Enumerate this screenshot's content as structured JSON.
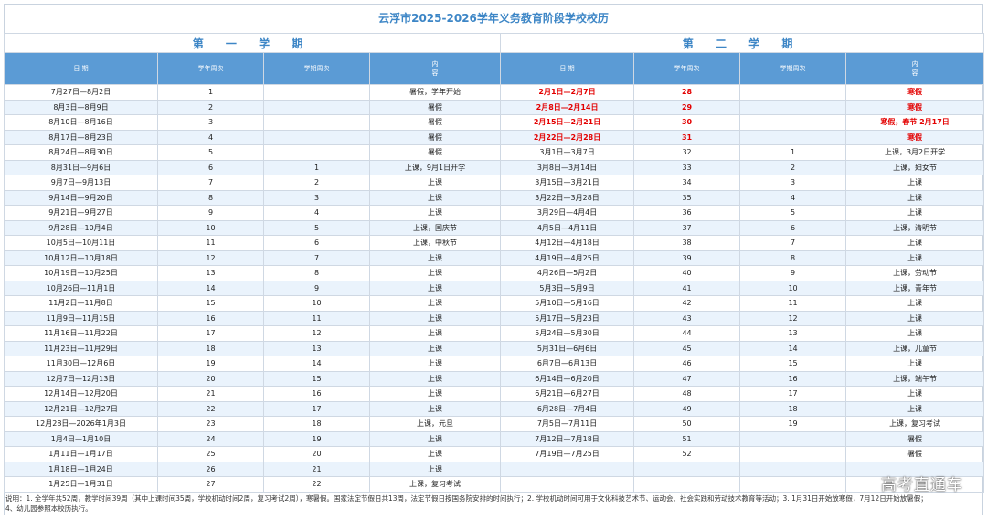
{
  "title": "云浮市2025-2026学年义务教育阶段学校校历",
  "semester1_label": "第 一 学 期",
  "semester2_label": "第 二 学 期",
  "headers": {
    "date": "日 期",
    "school_week": "学年周次",
    "term_week": "学期周次",
    "content": "内\n容"
  },
  "rows": [
    {
      "d1": "7月27日—8月2日",
      "w1": "1",
      "t1": "",
      "c1": "暑假，学年开始",
      "d2": "2月1日—2月7日",
      "w2": "28",
      "t2": "",
      "c2": "寒假",
      "hol": true
    },
    {
      "d1": "8月3日—8月9日",
      "w1": "2",
      "t1": "",
      "c1": "暑假",
      "d2": "2月8日—2月14日",
      "w2": "29",
      "t2": "",
      "c2": "寒假",
      "hol": true
    },
    {
      "d1": "8月10日—8月16日",
      "w1": "3",
      "t1": "",
      "c1": "暑假",
      "d2": "2月15日—2月21日",
      "w2": "30",
      "t2": "",
      "c2": "寒假，春节 2月17日",
      "hol": true
    },
    {
      "d1": "8月17日—8月23日",
      "w1": "4",
      "t1": "",
      "c1": "暑假",
      "d2": "2月22日—2月28日",
      "w2": "31",
      "t2": "",
      "c2": "寒假",
      "hol": true
    },
    {
      "d1": "8月24日—8月30日",
      "w1": "5",
      "t1": "",
      "c1": "暑假",
      "d2": "3月1日—3月7日",
      "w2": "32",
      "t2": "1",
      "c2": "上课，3月2日开学",
      "hol": false
    },
    {
      "d1": "8月31日—9月6日",
      "w1": "6",
      "t1": "1",
      "c1": "上课，9月1日开学",
      "d2": "3月8日—3月14日",
      "w2": "33",
      "t2": "2",
      "c2": "上课，妇女节",
      "hol": false
    },
    {
      "d1": "9月7日—9月13日",
      "w1": "7",
      "t1": "2",
      "c1": "上课",
      "d2": "3月15日—3月21日",
      "w2": "34",
      "t2": "3",
      "c2": "上课",
      "hol": false
    },
    {
      "d1": "9月14日—9月20日",
      "w1": "8",
      "t1": "3",
      "c1": "上课",
      "d2": "3月22日—3月28日",
      "w2": "35",
      "t2": "4",
      "c2": "上课",
      "hol": false
    },
    {
      "d1": "9月21日—9月27日",
      "w1": "9",
      "t1": "4",
      "c1": "上课",
      "d2": "3月29日—4月4日",
      "w2": "36",
      "t2": "5",
      "c2": "上课",
      "hol": false
    },
    {
      "d1": "9月28日—10月4日",
      "w1": "10",
      "t1": "5",
      "c1": "上课，国庆节",
      "d2": "4月5日—4月11日",
      "w2": "37",
      "t2": "6",
      "c2": "上课，清明节",
      "hol": false
    },
    {
      "d1": "10月5日—10月11日",
      "w1": "11",
      "t1": "6",
      "c1": "上课，中秋节",
      "d2": "4月12日—4月18日",
      "w2": "38",
      "t2": "7",
      "c2": "上课",
      "hol": false
    },
    {
      "d1": "10月12日—10月18日",
      "w1": "12",
      "t1": "7",
      "c1": "上课",
      "d2": "4月19日—4月25日",
      "w2": "39",
      "t2": "8",
      "c2": "上课",
      "hol": false
    },
    {
      "d1": "10月19日—10月25日",
      "w1": "13",
      "t1": "8",
      "c1": "上课",
      "d2": "4月26日—5月2日",
      "w2": "40",
      "t2": "9",
      "c2": "上课，劳动节",
      "hol": false
    },
    {
      "d1": "10月26日—11月1日",
      "w1": "14",
      "t1": "9",
      "c1": "上课",
      "d2": "5月3日—5月9日",
      "w2": "41",
      "t2": "10",
      "c2": "上课，青年节",
      "hol": false
    },
    {
      "d1": "11月2日—11月8日",
      "w1": "15",
      "t1": "10",
      "c1": "上课",
      "d2": "5月10日—5月16日",
      "w2": "42",
      "t2": "11",
      "c2": "上课",
      "hol": false
    },
    {
      "d1": "11月9日—11月15日",
      "w1": "16",
      "t1": "11",
      "c1": "上课",
      "d2": "5月17日—5月23日",
      "w2": "43",
      "t2": "12",
      "c2": "上课",
      "hol": false
    },
    {
      "d1": "11月16日—11月22日",
      "w1": "17",
      "t1": "12",
      "c1": "上课",
      "d2": "5月24日—5月30日",
      "w2": "44",
      "t2": "13",
      "c2": "上课",
      "hol": false
    },
    {
      "d1": "11月23日—11月29日",
      "w1": "18",
      "t1": "13",
      "c1": "上课",
      "d2": "5月31日—6月6日",
      "w2": "45",
      "t2": "14",
      "c2": "上课，儿童节",
      "hol": false
    },
    {
      "d1": "11月30日—12月6日",
      "w1": "19",
      "t1": "14",
      "c1": "上课",
      "d2": "6月7日—6月13日",
      "w2": "46",
      "t2": "15",
      "c2": "上课",
      "hol": false
    },
    {
      "d1": "12月7日—12月13日",
      "w1": "20",
      "t1": "15",
      "c1": "上课",
      "d2": "6月14日—6月20日",
      "w2": "47",
      "t2": "16",
      "c2": "上课，端午节",
      "hol": false
    },
    {
      "d1": "12月14日—12月20日",
      "w1": "21",
      "t1": "16",
      "c1": "上课",
      "d2": "6月21日—6月27日",
      "w2": "48",
      "t2": "17",
      "c2": "上课",
      "hol": false
    },
    {
      "d1": "12月21日—12月27日",
      "w1": "22",
      "t1": "17",
      "c1": "上课",
      "d2": "6月28日—7月4日",
      "w2": "49",
      "t2": "18",
      "c2": "上课",
      "hol": false
    },
    {
      "d1": "12月28日—2026年1月3日",
      "w1": "23",
      "t1": "18",
      "c1": "上课，元旦",
      "d2": "7月5日—7月11日",
      "w2": "50",
      "t2": "19",
      "c2": "上课，复习考试",
      "hol": false
    },
    {
      "d1": "1月4日—1月10日",
      "w1": "24",
      "t1": "19",
      "c1": "上课",
      "d2": "7月12日—7月18日",
      "w2": "51",
      "t2": "",
      "c2": "暑假",
      "hol": false
    },
    {
      "d1": "1月11日—1月17日",
      "w1": "25",
      "t1": "20",
      "c1": "上课",
      "d2": "7月19日—7月25日",
      "w2": "52",
      "t2": "",
      "c2": "暑假",
      "hol": false
    },
    {
      "d1": "1月18日—1月24日",
      "w1": "26",
      "t1": "21",
      "c1": "上课",
      "d2": "",
      "w2": "",
      "t2": "",
      "c2": "",
      "hol": false
    },
    {
      "d1": "1月25日—1月31日",
      "w1": "27",
      "t1": "22",
      "c1": "上课，复习考试",
      "d2": "",
      "w2": "",
      "t2": "",
      "c2": "",
      "hol": false
    }
  ],
  "note": "说明：1. 全学年共52周，教学时间39周（其中上课时间35周，学校机动时间2周，复习考试2周），寒暑假。国家法定节假日共13周，法定节假日按国务院安排的时间执行；2. 学校机动时间可用于文化科技艺术节、运动会、社会实践和劳动技术教育等活动；3. 1月31日开始放寒假，7月12日开始放暑假；4、幼儿园参照本校历执行。",
  "watermark": "高考直通车"
}
